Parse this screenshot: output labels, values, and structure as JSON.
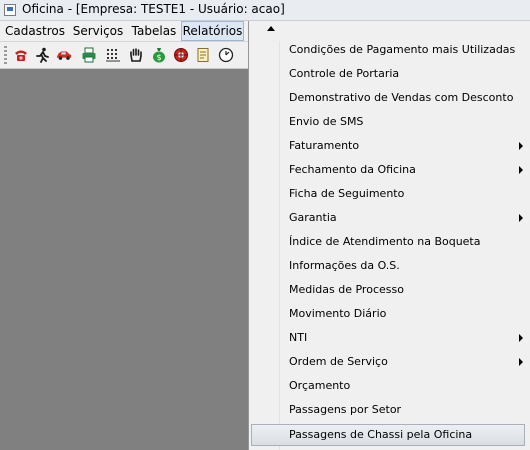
{
  "window": {
    "title": "Oficina - [Empresa: TESTE1 - Usuário: acao]",
    "icon": "app-window-icon"
  },
  "menubar": {
    "items": [
      {
        "label": "Cadastros"
      },
      {
        "label": "Serviços"
      },
      {
        "label": "Tabelas"
      },
      {
        "label": "Relatórios",
        "active": true
      }
    ]
  },
  "toolbar": {
    "icons": [
      "telephone-icon",
      "running-man-icon",
      "car-icon",
      "printer-icon",
      "grid-icon",
      "hand-icon",
      "money-bag-icon",
      "wheel-icon",
      "notepad-icon",
      "clock-icon"
    ]
  },
  "dropdown": {
    "items": [
      {
        "label": "Condições de Pagamento mais Utilizadas",
        "submenu": false
      },
      {
        "label": "Controle de Portaria",
        "submenu": false
      },
      {
        "label": "Demonstrativo de Vendas com Desconto",
        "submenu": false
      },
      {
        "label": "Envio de SMS",
        "submenu": false
      },
      {
        "label": "Faturamento",
        "submenu": true
      },
      {
        "label": "Fechamento da Oficina",
        "submenu": true
      },
      {
        "label": "Ficha de Seguimento",
        "submenu": false
      },
      {
        "label": "Garantia",
        "submenu": true
      },
      {
        "label": "Índice de Atendimento na Boqueta",
        "submenu": false
      },
      {
        "label": "Informações da O.S.",
        "submenu": false
      },
      {
        "label": "Medidas de Processo",
        "submenu": false
      },
      {
        "label": "Movimento Diário",
        "submenu": false
      },
      {
        "label": "NTI",
        "submenu": true
      },
      {
        "label": "Ordem de Serviço",
        "submenu": true
      },
      {
        "label": "Orçamento",
        "submenu": false
      },
      {
        "label": "Passagens por Setor",
        "submenu": false
      },
      {
        "label": "Passagens de Chassi pela Oficina",
        "submenu": false,
        "highlighted": true
      }
    ]
  }
}
